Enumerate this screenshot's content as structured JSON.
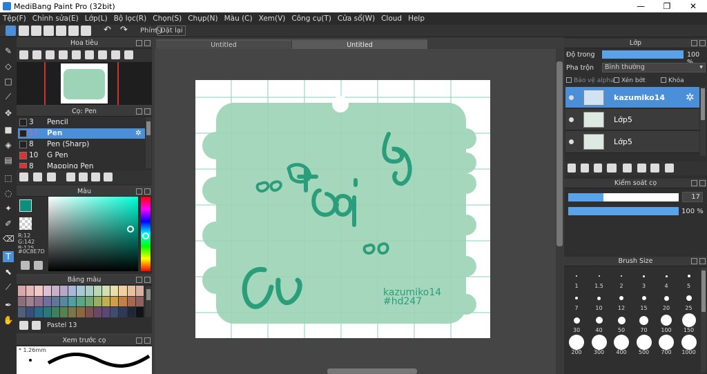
{
  "window": {
    "title": "MediBang Paint Pro (32bit)",
    "minimize": "—",
    "maximize": "❐",
    "close": "✕"
  },
  "menu": [
    "Tệp(F)",
    "Chỉnh sửa(E)",
    "Lớp(L)",
    "Bộ lọc(R)",
    "Chọn(S)",
    "Chụp(N)",
    "Màu (C)",
    "Xem(V)",
    "Công cụ(T)",
    "Cửa sổ(W)",
    "Cloud",
    "Help"
  ],
  "toolbar": {
    "shortcut_label": "Phím",
    "reset_label": "Đặt lại"
  },
  "navigator": {
    "title": "Hoa tiêu"
  },
  "brush_panel": {
    "title": "Cọ: Pen",
    "items": [
      {
        "size": "3",
        "name": "Pencil",
        "color": "#222222"
      },
      {
        "size": "17",
        "name": "Pen",
        "color": "#222222"
      },
      {
        "size": "8",
        "name": "Pen (Sharp)",
        "color": "#222222"
      },
      {
        "size": "10",
        "name": "G Pen",
        "color": "#e03030"
      },
      {
        "size": "8",
        "name": "Mapping Pen",
        "color": "#e03030"
      }
    ],
    "selected_index": 1
  },
  "color_panel": {
    "title": "Màu",
    "r": "R:12",
    "g": "G:142",
    "b": "B:125",
    "hex": "#0C8E7D",
    "fg_color": "#0c8e7d"
  },
  "palette": {
    "title": "Bảng màu",
    "name": "Pastel 13"
  },
  "brush_preview": {
    "title": "Xem trước cọ",
    "size": "* 1.26mm"
  },
  "tabs": [
    {
      "label": "Untitled"
    },
    {
      "label": "Untitled"
    }
  ],
  "canvas": {
    "signature": "kazumiko14",
    "tag": "#hd247",
    "blob_color": "#9dd4b7",
    "text_color": "#2a9e7a"
  },
  "layers": {
    "title": "Lớp",
    "opacity_label": "Độ trong",
    "opacity_value": "100 %",
    "opacity": 1.0,
    "blend_label": "Pha trộn",
    "blend_value": "Bình thường",
    "protect_alpha": "Bảo vệ alpha",
    "clipping": "Xén bớt",
    "lock": "Khóa",
    "items": [
      {
        "name": "kazumiko14"
      },
      {
        "name": "Lớp5"
      },
      {
        "name": "Lớp5"
      }
    ],
    "selected_index": 0
  },
  "brush_control": {
    "title": "Kiểm soát cọ",
    "size_value": "17",
    "size_fraction": 0.32,
    "opacity_value": "100 %",
    "opacity_fraction": 1.0
  },
  "brush_size": {
    "title": "Brush Size",
    "sizes": [
      "1",
      "1.5",
      "2",
      "3",
      "4",
      "5",
      "7",
      "10",
      "12",
      "15",
      "20",
      "25",
      "30",
      "40",
      "50",
      "70",
      "100",
      "150",
      "200",
      "300",
      "400",
      "500",
      "700",
      "1000"
    ]
  }
}
